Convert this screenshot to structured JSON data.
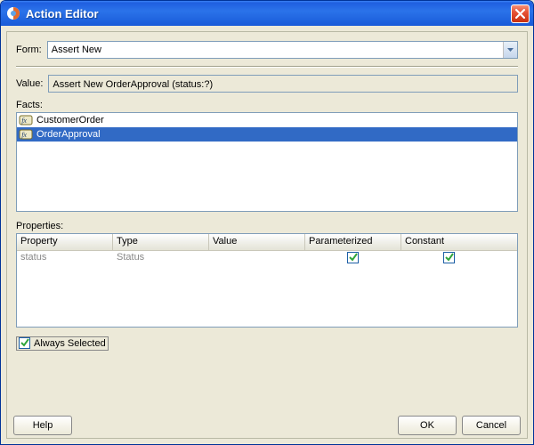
{
  "window": {
    "title": "Action Editor",
    "close_icon": "close-icon"
  },
  "form": {
    "label": "Form:",
    "selected": "Assert New"
  },
  "value": {
    "label": "Value:",
    "text": "Assert New OrderApproval (status:?)"
  },
  "facts": {
    "label": "Facts:",
    "items": [
      {
        "name": "CustomerOrder",
        "selected": false
      },
      {
        "name": "OrderApproval",
        "selected": true
      }
    ]
  },
  "properties": {
    "label": "Properties:",
    "columns": {
      "property": "Property",
      "type": "Type",
      "value": "Value",
      "parameterized": "Parameterized",
      "constant": "Constant"
    },
    "rows": [
      {
        "property": "status",
        "type": "Status",
        "value": "",
        "parameterized": true,
        "constant": true
      }
    ]
  },
  "always_selected": {
    "label": "Always Selected",
    "checked": true
  },
  "buttons": {
    "help": "Help",
    "ok": "OK",
    "cancel": "Cancel"
  },
  "colors": {
    "titlebar_start": "#3a81f5",
    "titlebar_end": "#185ad8",
    "selection": "#316ac5",
    "panel_bg": "#ece9d8",
    "check_color": "#2fa53b"
  }
}
